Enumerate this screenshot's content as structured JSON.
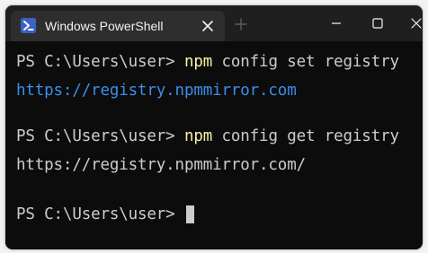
{
  "window": {
    "tab_title": "Windows PowerShell",
    "tab_icon": "powershell-icon",
    "new_tab_icon": "plus-icon",
    "controls": [
      "minimize-icon",
      "maximize-icon",
      "close-icon"
    ]
  },
  "colors": {
    "terminal_bg": "#0c0c0c",
    "titlebar_bg": "#1f1f1f",
    "tab_bg": "#2e2e2e",
    "text": "#cccccc",
    "command": "#f9f1a5",
    "link": "#3b8eea",
    "powershell_icon": "#3a62c7"
  },
  "terminal": {
    "lines": [
      {
        "prompt": "PS C:\\Users\\user> ",
        "command": "npm",
        "args": " config set registry"
      },
      {
        "output": "https://registry.npmmirror.com"
      },
      {
        "prompt": "PS C:\\Users\\user> ",
        "command": "npm",
        "args": " config get registry"
      },
      {
        "output": "https://registry.npmmirror.com/"
      },
      {
        "prompt": "PS C:\\Users\\user> "
      }
    ]
  }
}
